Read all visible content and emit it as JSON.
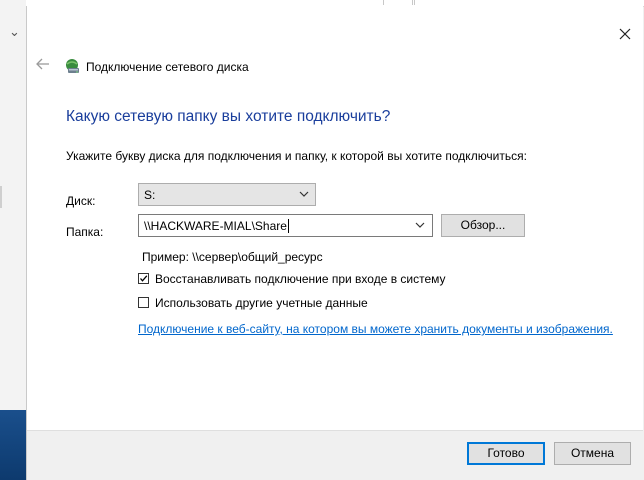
{
  "dialog": {
    "title": "Подключение сетевого диска",
    "heading": "Какую сетевую папку вы хотите подключить?",
    "instruction": "Укажите букву диска для подключения и папку, к которой вы хотите подключиться:"
  },
  "form": {
    "drive_label": "Диск:",
    "drive_value": "S:",
    "folder_label": "Папка:",
    "folder_value": "\\\\HACKWARE-MIAL\\Share",
    "browse_label": "Обзор...",
    "example_text": "Пример: \\\\сервер\\общий_ресурс"
  },
  "options": {
    "reconnect_label": "Восстанавливать подключение при входе в систему",
    "reconnect_checked": true,
    "other_credentials_label": "Использовать другие учетные данные",
    "other_credentials_checked": false,
    "website_link": "Подключение к веб-сайту, на котором вы можете хранить документы и изображения."
  },
  "footer": {
    "done_label": "Готово",
    "cancel_label": "Отмена"
  },
  "colors": {
    "heading": "#1a3e9c",
    "link": "#0066cc",
    "default_button_border": "#0078d7"
  },
  "icons": [
    "close-icon",
    "back-arrow-icon",
    "network-drive-icon",
    "chevron-down-icon",
    "checkmark-icon"
  ]
}
